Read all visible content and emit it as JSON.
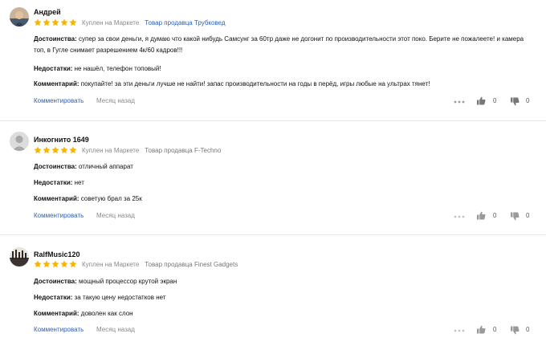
{
  "reviews": [
    {
      "author": "Андрей",
      "rating": 5,
      "bought_label": "Куплен на Маркете",
      "seller": "Товар продавца Трубковед",
      "fields": [
        {
          "label": "Достоинства:",
          "text": "супер за свои деньги, я думаю что какой нибудь Самсунг за 60тр даже не догонит по производительности этот поко. Берите не пожалеете! и камера топ, в Гугле снимает разрешением 4к/60 кадров!!!"
        },
        {
          "label": "Недостатки:",
          "text": "не нашёл, телефон топовый!"
        },
        {
          "label": "Комментарий:",
          "text": "покупайте! за эти деньги лучше не найти! запас производительности на годы в перёд, игры любые на ультрах тянет!"
        }
      ],
      "comment_label": "Комментировать",
      "date": "Месяц назад",
      "likes": "0",
      "dislikes": "0"
    },
    {
      "author": "Инкогнито 1649",
      "rating": 5,
      "bought_label": "Куплен на Маркете",
      "seller": "Товар продавца F-Techno",
      "fields": [
        {
          "label": "Достоинства:",
          "text": "отличный аппарат"
        },
        {
          "label": "Недостатки:",
          "text": "нет"
        },
        {
          "label": "Комментарий:",
          "text": "советую брал за 25к"
        }
      ],
      "comment_label": "Комментировать",
      "date": "Месяц назад",
      "likes": "0",
      "dislikes": "0"
    },
    {
      "author": "RalfMusic120",
      "rating": 5,
      "bought_label": "Куплен на Маркете",
      "seller": "Товар продавца Finest Gadgets",
      "fields": [
        {
          "label": "Достоинства:",
          "text": "мощный процессор крутой экран"
        },
        {
          "label": "Недостатки:",
          "text": "за такую цену недостатков нет"
        },
        {
          "label": "Комментарий:",
          "text": "доволен как слон"
        }
      ],
      "comment_label": "Комментировать",
      "date": "Месяц назад",
      "likes": "0",
      "dislikes": "0"
    }
  ],
  "icons": {
    "star": "star-icon",
    "more": "more-dots-icon",
    "like": "thumb-up-icon",
    "dislike": "thumb-down-icon"
  },
  "colors": {
    "star": "#f6b600",
    "link": "#2b5fb4",
    "muted": "#8a8a8a"
  }
}
